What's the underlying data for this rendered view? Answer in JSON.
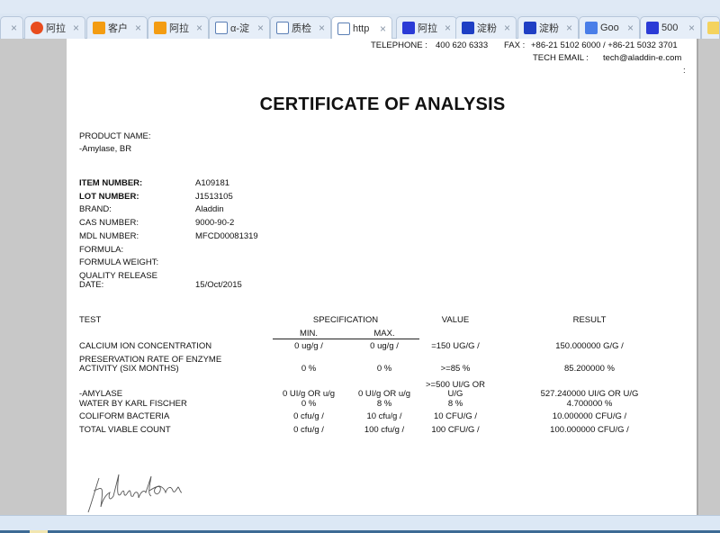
{
  "browser": {
    "tabs": [
      {
        "label": "",
        "icon": "partial-tab-icon",
        "active": false
      },
      {
        "label": "阿拉",
        "icon": "sogou-icon",
        "active": false
      },
      {
        "label": "客户",
        "icon": "aliwangwang-icon",
        "active": false
      },
      {
        "label": "阿拉",
        "icon": "aliwangwang-icon",
        "active": false
      },
      {
        "label": "α-淀",
        "icon": "document-icon",
        "active": false
      },
      {
        "label": "质检",
        "icon": "document-icon",
        "active": false
      },
      {
        "label": "http",
        "icon": "document-icon",
        "active": true
      },
      {
        "label": "阿拉",
        "icon": "baidu-paw-icon",
        "active": false
      },
      {
        "label": "淀粉",
        "icon": "app-grid-icon",
        "active": false
      },
      {
        "label": "淀粉",
        "icon": "app-grid-icon",
        "active": false
      },
      {
        "label": "Goo",
        "icon": "google-translate-icon",
        "active": false
      },
      {
        "label": "500",
        "icon": "baidu-paw-icon",
        "active": false
      },
      {
        "label": "",
        "icon": "notes-icon",
        "active": false
      }
    ],
    "close_glyph": "×"
  },
  "header": {
    "telephone_label": "TELEPHONE :",
    "telephone": "400 620 6333",
    "fax_label": "FAX :",
    "fax": "+86-21 5102 6000 / +86-21 5032 3701",
    "email_label": "TECH EMAIL :",
    "email": "tech@aladdin-e.com",
    "colon": ":"
  },
  "title": "CERTIFICATE OF ANALYSIS",
  "product": {
    "name_label": "PRODUCT NAME:",
    "name": "-Amylase, BR",
    "fields": [
      {
        "label": "ITEM NUMBER:",
        "value": "A109181",
        "bold": true
      },
      {
        "label": "LOT NUMBER:",
        "value": "J1513105",
        "bold": true
      },
      {
        "label": "BRAND:",
        "value": "Aladdin"
      },
      {
        "label": "CAS NUMBER:",
        "value": "9000-90-2"
      },
      {
        "label": "MDL NUMBER:",
        "value": "MFCD00081319"
      },
      {
        "label": "FORMULA:",
        "value": ""
      },
      {
        "label": "FORMULA WEIGHT:",
        "value": ""
      }
    ],
    "release_label_1": "QUALITY RELEASE",
    "release_label_2": "DATE:",
    "release_date": "15/Oct/2015"
  },
  "table": {
    "headers": {
      "test": "TEST",
      "spec": "SPECIFICATION",
      "min": "MIN.",
      "max": "MAX.",
      "value": "VALUE",
      "result": "RESULT"
    },
    "rows": [
      {
        "test": [
          "CALCIUM ION CONCENTRATION"
        ],
        "min": "0 ug/g /",
        "max": "0 ug/g /",
        "value": [
          "=150 UG/G /"
        ],
        "result": "150.000000 G/G /"
      },
      {
        "test": [
          "PRESERVATION RATE OF ENZYME",
          "ACTIVITY (SIX MONTHS)"
        ],
        "min": "0 %",
        "max": "0 %",
        "value": [
          ">=85 %"
        ],
        "result": "85.200000 %"
      },
      {
        "test": [
          "-AMYLASE"
        ],
        "min": "0 UI/g OR u/g",
        "max": "0 UI/g OR u/g",
        "value": [
          ">=500 UI/G OR",
          "U/G"
        ],
        "result": "527.240000 UI/G OR U/G"
      },
      {
        "test": [
          "WATER BY KARL FISCHER"
        ],
        "min": "0 %",
        "max": "8 %",
        "value": [
          "8 %"
        ],
        "result": "4.700000 %"
      },
      {
        "test": [
          "COLIFORM BACTERIA"
        ],
        "min": "0 cfu/g /",
        "max": "10 cfu/g /",
        "value": [
          "10 CFU/G /"
        ],
        "result": "10.000000 CFU/G /"
      },
      {
        "test": [
          "TOTAL VIABLE COUNT"
        ],
        "min": "0 cfu/g /",
        "max": "100 cfu/g /",
        "value": [
          "100 CFU/G /"
        ],
        "result": "100.000000 CFU/G /"
      }
    ]
  },
  "signature": "Julian Xu"
}
